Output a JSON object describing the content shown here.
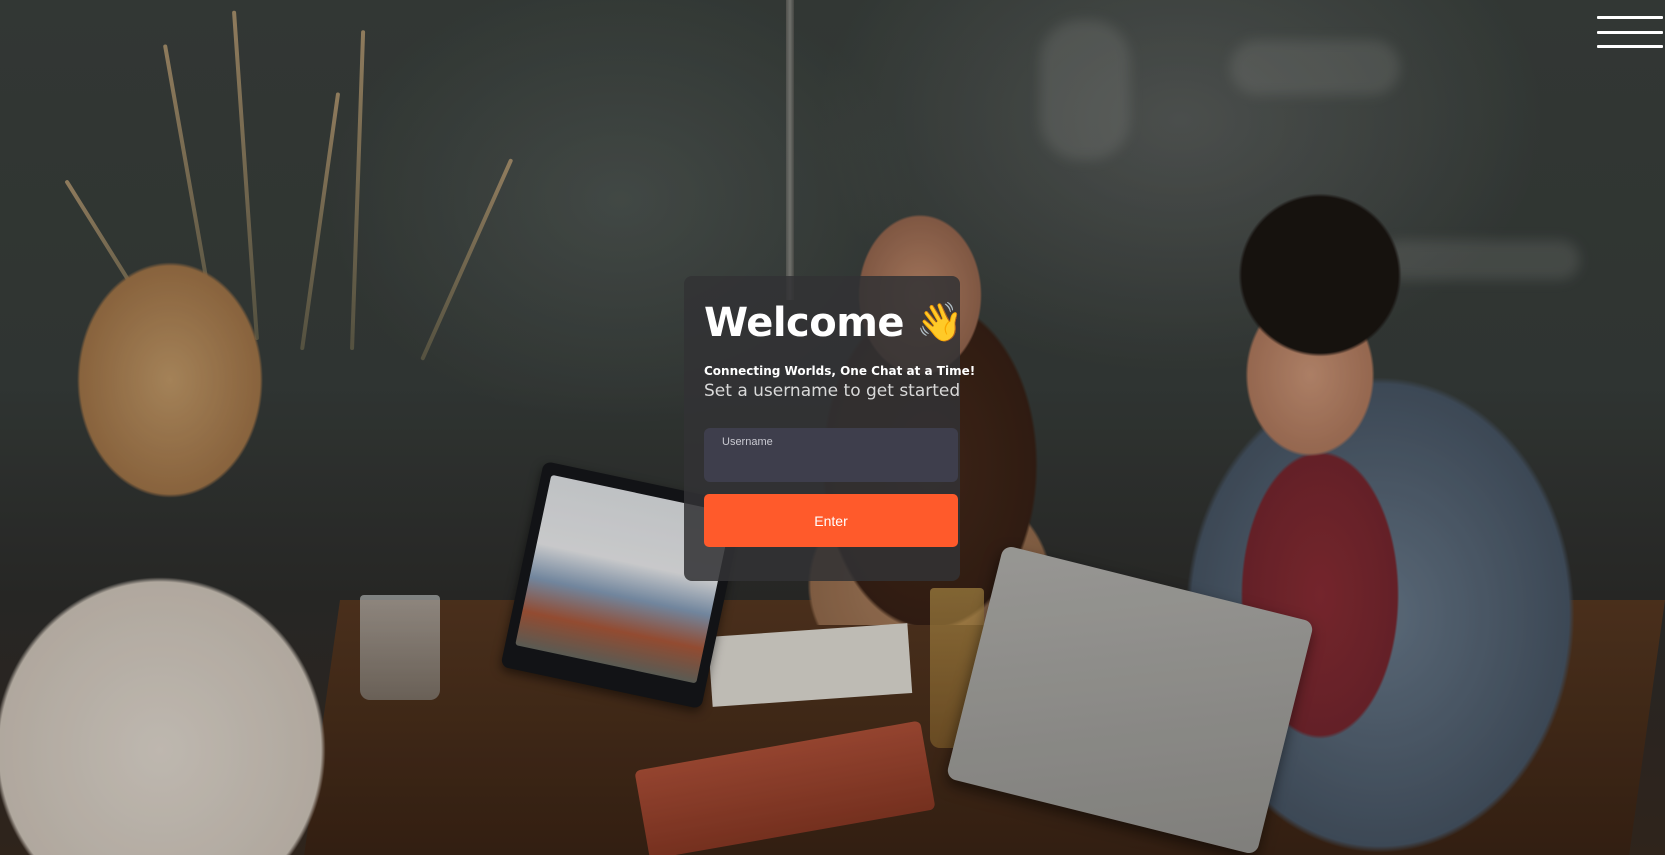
{
  "login": {
    "title": "Welcome",
    "title_emoji": "👋",
    "tagline": "Connecting Worlds, One Chat at a Time!",
    "subtitle": "Set a username to get started",
    "username_label": "Username",
    "username_value": "",
    "enter_label": "Enter"
  },
  "menu": {
    "icon": "hamburger-menu-icon"
  },
  "colors": {
    "accent": "#ff5a2b",
    "card_background": "#323234",
    "input_background": "#3e3e4c",
    "text_primary": "#ffffff"
  }
}
